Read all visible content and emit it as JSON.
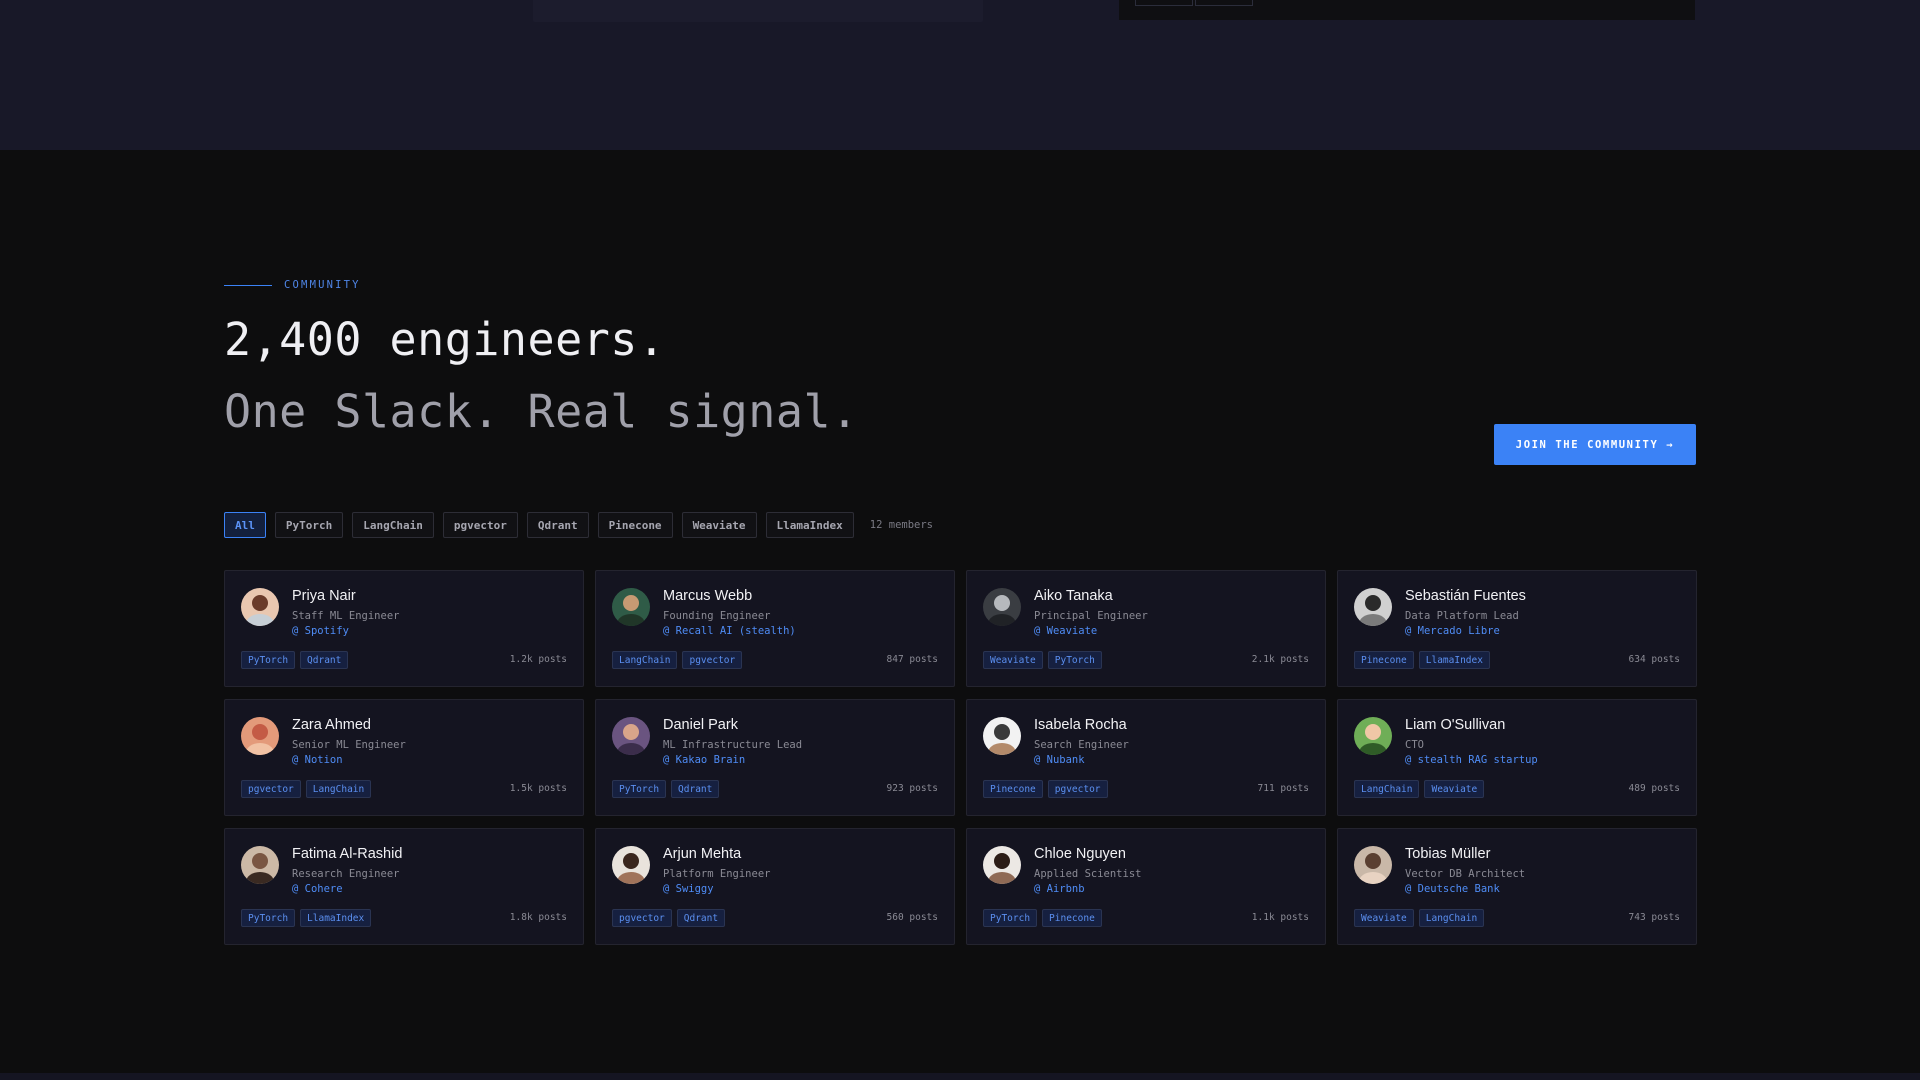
{
  "colors": {
    "accent": "#3b82f6",
    "background": "#0d0d0e",
    "card": "#141420",
    "top_band": "#181828"
  },
  "section": {
    "eyebrow": "COMMUNITY",
    "headline_line1": "2,400 engineers.",
    "headline_line2": "One Slack. Real signal.",
    "cta_label": "JOIN THE COMMUNITY →"
  },
  "filters": {
    "items": [
      "All",
      "PyTorch",
      "LangChain",
      "pgvector",
      "Qdrant",
      "Pinecone",
      "Weaviate",
      "LlamaIndex"
    ],
    "active": "All",
    "count_label": "12 members"
  },
  "members": [
    {
      "name": "Priya Nair",
      "role": "Staff ML Engineer",
      "company": "@ Spotify",
      "tags": [
        "PyTorch",
        "Qdrant"
      ],
      "posts": "1.2k posts",
      "avatar": "avatar-photo-icon"
    },
    {
      "name": "Marcus Webb",
      "role": "Founding Engineer",
      "company": "@ Recall AI (stealth)",
      "tags": [
        "LangChain",
        "pgvector"
      ],
      "posts": "847 posts",
      "avatar": "avatar-photo-icon"
    },
    {
      "name": "Aiko Tanaka",
      "role": "Principal Engineer",
      "company": "@ Weaviate",
      "tags": [
        "Weaviate",
        "PyTorch"
      ],
      "posts": "2.1k posts",
      "avatar": "avatar-photo-icon"
    },
    {
      "name": "Sebastián Fuentes",
      "role": "Data Platform Lead",
      "company": "@ Mercado Libre",
      "tags": [
        "Pinecone",
        "LlamaIndex"
      ],
      "posts": "634 posts",
      "avatar": "avatar-photo-icon"
    },
    {
      "name": "Zara Ahmed",
      "role": "Senior ML Engineer",
      "company": "@ Notion",
      "tags": [
        "pgvector",
        "LangChain"
      ],
      "posts": "1.5k posts",
      "avatar": "avatar-photo-icon"
    },
    {
      "name": "Daniel Park",
      "role": "ML Infrastructure Lead",
      "company": "@ Kakao Brain",
      "tags": [
        "PyTorch",
        "Qdrant"
      ],
      "posts": "923 posts",
      "avatar": "avatar-photo-icon"
    },
    {
      "name": "Isabela Rocha",
      "role": "Search Engineer",
      "company": "@ Nubank",
      "tags": [
        "Pinecone",
        "pgvector"
      ],
      "posts": "711 posts",
      "avatar": "avatar-photo-icon"
    },
    {
      "name": "Liam O'Sullivan",
      "role": "CTO",
      "company": "@ stealth RAG startup",
      "tags": [
        "LangChain",
        "Weaviate"
      ],
      "posts": "489 posts",
      "avatar": "avatar-photo-icon"
    },
    {
      "name": "Fatima Al-Rashid",
      "role": "Research Engineer",
      "company": "@ Cohere",
      "tags": [
        "PyTorch",
        "LlamaIndex"
      ],
      "posts": "1.8k posts",
      "avatar": "avatar-photo-icon"
    },
    {
      "name": "Arjun Mehta",
      "role": "Platform Engineer",
      "company": "@ Swiggy",
      "tags": [
        "pgvector",
        "Qdrant"
      ],
      "posts": "560 posts",
      "avatar": "avatar-photo-icon"
    },
    {
      "name": "Chloe Nguyen",
      "role": "Applied Scientist",
      "company": "@ Airbnb",
      "tags": [
        "PyTorch",
        "Pinecone"
      ],
      "posts": "1.1k posts",
      "avatar": "avatar-photo-icon"
    },
    {
      "name": "Tobias Müller",
      "role": "Vector DB Architect",
      "company": "@ Deutsche Bank",
      "tags": [
        "Weaviate",
        "LangChain"
      ],
      "posts": "743 posts",
      "avatar": "avatar-photo-icon"
    }
  ]
}
